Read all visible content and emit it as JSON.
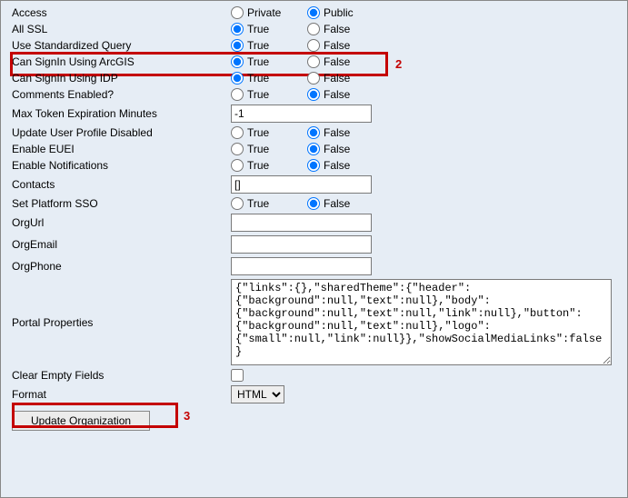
{
  "rows": {
    "access": {
      "label": "Access",
      "opt1": "Private",
      "opt2": "Public"
    },
    "allSsl": {
      "label": "All SSL",
      "opt1": "True",
      "opt2": "False"
    },
    "useStdQuery": {
      "label": "Use Standardized Query",
      "opt1": "True",
      "opt2": "False"
    },
    "canSigninArcgis": {
      "label": "Can SignIn Using ArcGIS",
      "opt1": "True",
      "opt2": "False"
    },
    "canSigninIdp": {
      "label": "Can SignIn Using IDP",
      "opt1": "True",
      "opt2": "False"
    },
    "commentsEnabled": {
      "label": "Comments Enabled?",
      "opt1": "True",
      "opt2": "False"
    },
    "maxTokenExp": {
      "label": "Max Token Expiration Minutes",
      "value": "-1"
    },
    "updateUserProfile": {
      "label": "Update User Profile Disabled",
      "opt1": "True",
      "opt2": "False"
    },
    "enableEuei": {
      "label": "Enable EUEI",
      "opt1": "True",
      "opt2": "False"
    },
    "enableNotifications": {
      "label": "Enable Notifications",
      "opt1": "True",
      "opt2": "False"
    },
    "contacts": {
      "label": "Contacts",
      "value": "[]"
    },
    "setPlatformSso": {
      "label": "Set Platform SSO",
      "opt1": "True",
      "opt2": "False"
    },
    "orgUrl": {
      "label": "OrgUrl",
      "value": ""
    },
    "orgEmail": {
      "label": "OrgEmail",
      "value": ""
    },
    "orgPhone": {
      "label": "OrgPhone",
      "value": ""
    },
    "portalProperties": {
      "label": "Portal Properties",
      "value": "{\"links\":{},\"sharedTheme\":{\"header\":{\"background\":null,\"text\":null},\"body\":{\"background\":null,\"text\":null,\"link\":null},\"button\":{\"background\":null,\"text\":null},\"logo\":{\"small\":null,\"link\":null}},\"showSocialMediaLinks\":false}"
    },
    "clearEmptyFields": {
      "label": "Clear Empty Fields"
    },
    "format": {
      "label": "Format",
      "selected": "HTML",
      "options": [
        "HTML"
      ]
    }
  },
  "submit": {
    "label": "Update Organization"
  },
  "annotations": {
    "two": "2",
    "three": "3"
  }
}
